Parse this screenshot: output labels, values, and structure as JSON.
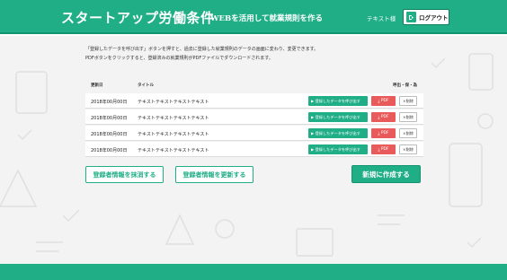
{
  "header": {
    "title": "スタートアップ労働条件",
    "subtitle": "WEBを活用して就業規則を作る",
    "user_label": "テキスト様",
    "logout_label": "ログアウト",
    "icon": "logout-icon"
  },
  "intro": {
    "line1": "「登録したデータを呼び出す」ボタンを押すと、過去に登録した就業規則のデータの画面に変わり、変更できます。",
    "line2": "PDFボタンをクリックすると、登録済みの就業規則がPDFファイルでダウンロードされます。"
  },
  "table": {
    "col_date": "更新日",
    "col_title": "タイトル",
    "col_actions": "呼出・保・為",
    "rows": [
      {
        "date": "2018年00月00日",
        "title": "テキストテキストテキストテキスト",
        "call_label": "登録したデータを呼び出す",
        "pdf_label": "PDF",
        "delete_label": "削除"
      },
      {
        "date": "2018年00月00日",
        "title": "テキストテキストテキストテキスト",
        "call_label": "登録したデータを呼び出す",
        "pdf_label": "PDF",
        "delete_label": "削除"
      },
      {
        "date": "2018年00月00日",
        "title": "テキストテキストテキストテキスト",
        "call_label": "登録したデータを呼び出す",
        "pdf_label": "PDF",
        "delete_label": "削除"
      },
      {
        "date": "2018年00月00日",
        "title": "テキストテキストテキストテキスト",
        "call_label": "登録したデータを呼び出す",
        "pdf_label": "PDF",
        "delete_label": "削除"
      }
    ]
  },
  "actions": {
    "extract_label": "登録者情報を抹消する",
    "update_label": "登録者情報を更新する",
    "create_label": "新規に作成する"
  },
  "colors": {
    "brand": "#1fae86",
    "pdf": "#e95b5b",
    "background": "#f3f3f3"
  }
}
